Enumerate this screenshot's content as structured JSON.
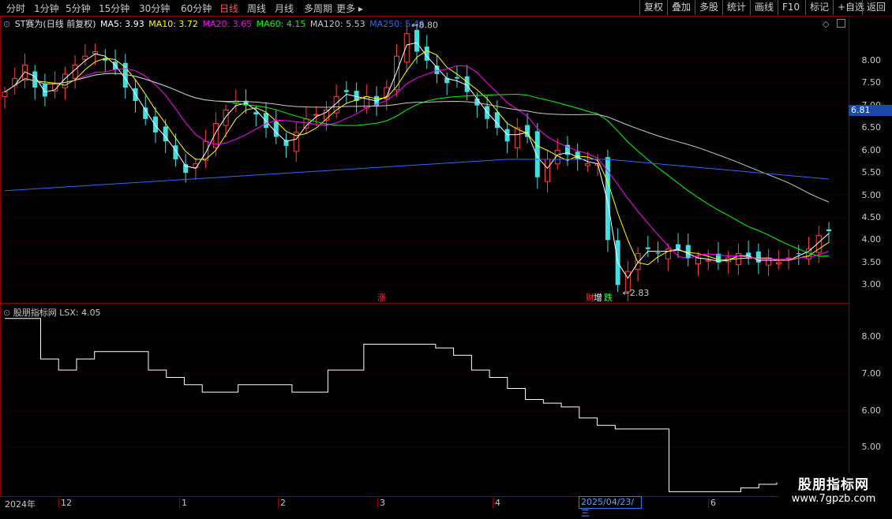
{
  "toolbar": {
    "periods": [
      "分时",
      "1分钟",
      "5分钟",
      "15分钟",
      "30分钟",
      "60分钟",
      "日线",
      "周线",
      "月线",
      "多周期",
      "更多"
    ],
    "active_period": "日线",
    "right_buttons": [
      "复权",
      "叠加",
      "多股",
      "统计",
      "画线",
      "F10",
      "标记",
      "+自选",
      "返回"
    ]
  },
  "main_chart": {
    "stock_label": "ST赛为(日线 前复权)",
    "ma": [
      {
        "label": "MA5: 3.93",
        "color": "#ffffff"
      },
      {
        "label": "MA10: 3.72",
        "color": "#ffff00"
      },
      {
        "label": "MA20: 3.65",
        "color": "#ff00ff"
      },
      {
        "label": "MA60: 4.15",
        "color": "#00ff00"
      },
      {
        "label": "MA120: 5.53",
        "color": "#c8c8c8"
      },
      {
        "label": "MA250: 5.46",
        "color": "#3366ff"
      }
    ],
    "y_ticks": [
      "8.00",
      "7.50",
      "7.00",
      "6.50",
      "6.00",
      "5.50",
      "5.00",
      "4.50",
      "4.00",
      "3.50",
      "3.00"
    ],
    "current_price": "6.81",
    "high_marker": "8.80",
    "low_marker": "2.83",
    "event_labels": [
      "涨",
      "财",
      "增",
      "跌"
    ]
  },
  "sub_chart": {
    "title": "股朋指标网",
    "value_label": "LSX: 4.05",
    "y_ticks": [
      "8.00",
      "7.00",
      "6.00",
      "5.00"
    ]
  },
  "x_axis": {
    "labels": [
      "2024年",
      "12",
      "1",
      "2",
      "3",
      "4",
      "2025/04/23/三",
      "6"
    ]
  },
  "watermark": {
    "title": "股朋指标网",
    "url": "www.7gpzb.com"
  },
  "chart_data": [
    {
      "type": "candlestick",
      "title": "ST赛为(日线 前复权)",
      "ylim": [
        2.6,
        9.0
      ],
      "series": [
        {
          "name": "MA5",
          "value": 3.93
        },
        {
          "name": "MA10",
          "value": 3.72
        },
        {
          "name": "MA20",
          "value": 3.65
        },
        {
          "name": "MA60",
          "value": 4.15
        },
        {
          "name": "MA120",
          "value": 5.53
        },
        {
          "name": "MA250",
          "value": 5.46
        }
      ],
      "close_trend": [
        7.3,
        7.6,
        7.9,
        7.4,
        7.2,
        7.5,
        7.7,
        7.9,
        8.1,
        8.2,
        8.0,
        7.8,
        7.4,
        7.1,
        6.7,
        6.4,
        6.2,
        5.8,
        5.5,
        5.7,
        6.2,
        6.6,
        6.9,
        7.1,
        7.0,
        6.8,
        6.5,
        6.3,
        6.1,
        6.4,
        6.7,
        6.8,
        6.9,
        7.2,
        7.3,
        7.1,
        7.2,
        7.0,
        7.4,
        8.1,
        8.6,
        8.2,
        8.0,
        7.7,
        7.5,
        7.6,
        7.3,
        7.0,
        6.7,
        6.5,
        6.2,
        6.5,
        6.3,
        5.4,
        5.8,
        6.0,
        5.9,
        5.8,
        5.7,
        5.7,
        4.0,
        3.0,
        3.3,
        3.7,
        3.8,
        3.7,
        3.8,
        3.8,
        3.6,
        3.6,
        3.55,
        3.5,
        3.6,
        3.7,
        3.6,
        3.5,
        3.6,
        3.5,
        3.6,
        3.7,
        3.8,
        4.1,
        4.2
      ],
      "high": 8.8,
      "low": 2.83,
      "current": 6.81
    },
    {
      "type": "line",
      "title": "股朋指标网",
      "series": [
        {
          "name": "LSX",
          "values": [
            8.5,
            8.5,
            7.4,
            7.1,
            7.4,
            7.6,
            7.6,
            7.6,
            7.1,
            6.9,
            6.7,
            6.5,
            6.5,
            6.7,
            6.7,
            6.7,
            6.5,
            6.5,
            7.1,
            7.1,
            7.8,
            7.8,
            7.8,
            7.8,
            7.7,
            7.5,
            7.1,
            6.9,
            6.6,
            6.3,
            6.2,
            6.1,
            5.8,
            5.6,
            5.5,
            5.5,
            5.5,
            3.8,
            3.8,
            3.8,
            3.8,
            3.9,
            4.0,
            4.05
          ]
        }
      ],
      "ylim": [
        3.7,
        8.9
      ]
    }
  ]
}
